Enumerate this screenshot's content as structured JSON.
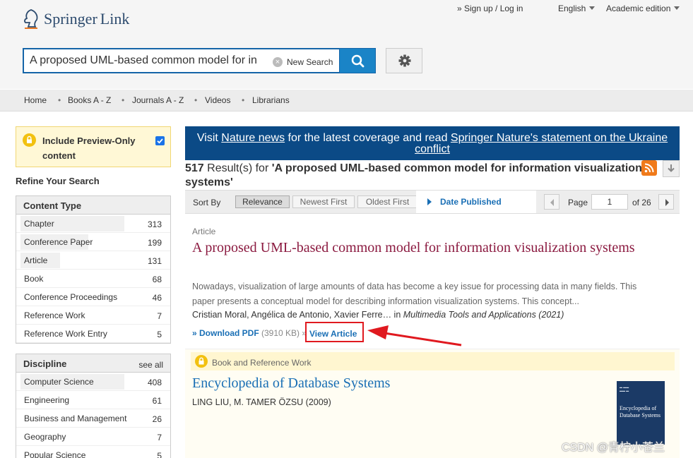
{
  "brand": {
    "name": "Springer",
    "name_suffix": "Link"
  },
  "top_links": {
    "signup": "» Sign up / Log in",
    "language": "English",
    "edition": "Academic edition"
  },
  "search": {
    "value": "A proposed UML-based common model for in",
    "new_search_label": "New Search"
  },
  "nav": [
    "Home",
    "Books A - Z",
    "Journals A - Z",
    "Videos",
    "Librarians"
  ],
  "preview": {
    "label": "Include Preview-Only content",
    "checked": true
  },
  "refine_label": "Refine Your Search",
  "content_type": {
    "title": "Content Type",
    "items": [
      {
        "label": "Chapter",
        "count": "313",
        "fill": 0.92
      },
      {
        "label": "Conference Paper",
        "count": "199",
        "fill": 0.6
      },
      {
        "label": "Article",
        "count": "131",
        "fill": 0.35
      },
      {
        "label": "Book",
        "count": "68",
        "fill": 0.0
      },
      {
        "label": "Conference Proceedings",
        "count": "46",
        "fill": 0.0
      },
      {
        "label": "Reference Work",
        "count": "7",
        "fill": 0.0
      },
      {
        "label": "Reference Work Entry",
        "count": "5",
        "fill": 0.0
      }
    ]
  },
  "discipline": {
    "title": "Discipline",
    "see_all": "see all",
    "items": [
      {
        "label": "Computer Science",
        "count": "408",
        "fill": 0.92
      },
      {
        "label": "Engineering",
        "count": "61",
        "fill": 0.0
      },
      {
        "label": "Business and Management",
        "count": "26",
        "fill": 0.0
      },
      {
        "label": "Geography",
        "count": "7",
        "fill": 0.0
      },
      {
        "label": "Popular Science",
        "count": "5",
        "fill": 0.0
      }
    ]
  },
  "banner": {
    "part1": "Visit ",
    "link1": "Nature news",
    "part2": " for the latest coverage and read ",
    "link2": "Springer Nature's statement on the Ukraine conflict"
  },
  "results": {
    "count": "517",
    "text": " Result(s) for ",
    "query": "'A proposed UML-based common model for information visualization systems'"
  },
  "sort": {
    "label": "Sort By",
    "options": [
      "Relevance",
      "Newest First",
      "Oldest First"
    ],
    "active": "Relevance",
    "date_label": "Date Published"
  },
  "pagination": {
    "label": "Page",
    "current": "1",
    "of": "of 26"
  },
  "result1": {
    "type": "Article",
    "title": "A proposed UML-based common model for information visualization systems",
    "snippet": "Nowadays, visualization of large amounts of data has become a key issue for processing data in many fields. This paper presents a conceptual model for describing information visualization systems. This concept...",
    "authors": "Cristian Moral, Angélica de Antonio, Xavier Ferre… in ",
    "journal": "Multimedia Tools and Applications (2021)",
    "download_label": "» Download PDF",
    "download_size": "(3910 KB)",
    "sep": "»",
    "view_label": "View Article"
  },
  "result2": {
    "type": "Book and Reference Work",
    "title": "Encyclopedia of Database Systems",
    "authors": "LING LIU, M. TAMER ÖZSU (2009)",
    "cover_title": "Encyclopedia of Database Systems"
  },
  "watermark": "CSDN @青柠小苍兰",
  "colors": {
    "brand_blue": "#1a84c7",
    "title_red": "#8b1a40",
    "link_blue": "#1a6fb5",
    "banner": "#0b4a86",
    "highlight": "#e0191f"
  }
}
